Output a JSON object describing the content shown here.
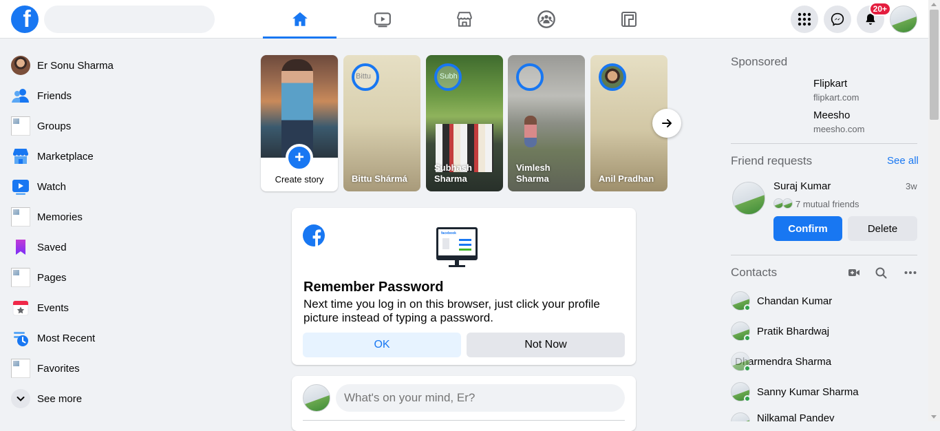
{
  "header": {
    "logo_letter": "f",
    "search_placeholder": "",
    "nav_tabs": [
      "home-icon",
      "watch-icon",
      "marketplace-icon",
      "groups-icon",
      "gaming-icon"
    ],
    "notification_badge": "20+"
  },
  "sidebar": {
    "items": [
      {
        "label": "Er Sonu Sharma",
        "icon": "profile-avatar"
      },
      {
        "label": "Friends",
        "icon": "friends-icon"
      },
      {
        "label": "Groups",
        "icon": "broken-image"
      },
      {
        "label": "Marketplace",
        "icon": "marketplace-icon"
      },
      {
        "label": "Watch",
        "icon": "watch-icon"
      },
      {
        "label": "Memories",
        "icon": "broken-image"
      },
      {
        "label": "Saved",
        "icon": "saved-icon"
      },
      {
        "label": "Pages",
        "icon": "broken-image"
      },
      {
        "label": "Events",
        "icon": "events-icon"
      },
      {
        "label": "Most Recent",
        "icon": "most-recent-icon"
      },
      {
        "label": "Favorites",
        "icon": "broken-image"
      },
      {
        "label": "See more",
        "icon": "chevron-down-icon"
      }
    ]
  },
  "stories": {
    "create_label": "Create story",
    "items": [
      {
        "name": "Bittu Shármá",
        "alt": "Bittu"
      },
      {
        "name": "Subhash Sharma",
        "alt": "Subh"
      },
      {
        "name": "Vimlesh Sharma",
        "alt": ""
      },
      {
        "name": "Anil Pradhan",
        "alt": ""
      }
    ]
  },
  "remember_password": {
    "title": "Remember Password",
    "text": "Next time you log in on this browser, just click your profile picture instead of typing a password.",
    "ok_label": "OK",
    "not_now_label": "Not Now",
    "illustration_brand": "facebook"
  },
  "composer": {
    "placeholder": "What's on your mind, Er?"
  },
  "right": {
    "sponsored_title": "Sponsored",
    "sponsored": [
      {
        "name": "Flipkart",
        "url": "flipkart.com"
      },
      {
        "name": "Meesho",
        "url": "meesho.com"
      }
    ],
    "friend_requests_title": "Friend requests",
    "see_all": "See all",
    "request": {
      "name": "Suraj Kumar",
      "time": "3w",
      "mutual": "7 mutual friends",
      "confirm": "Confirm",
      "delete": "Delete"
    },
    "contacts_title": "Contacts",
    "contacts": [
      "Chandan Kumar",
      "Pratik Bhardwaj",
      "Dharmendra Sharma",
      "Sanny Kumar Sharma",
      "Nilkamal Pandey"
    ]
  },
  "colors": {
    "brand": "#1877f2",
    "background": "#f0f2f5",
    "badge": "#e41e3f",
    "online": "#31a24c"
  }
}
